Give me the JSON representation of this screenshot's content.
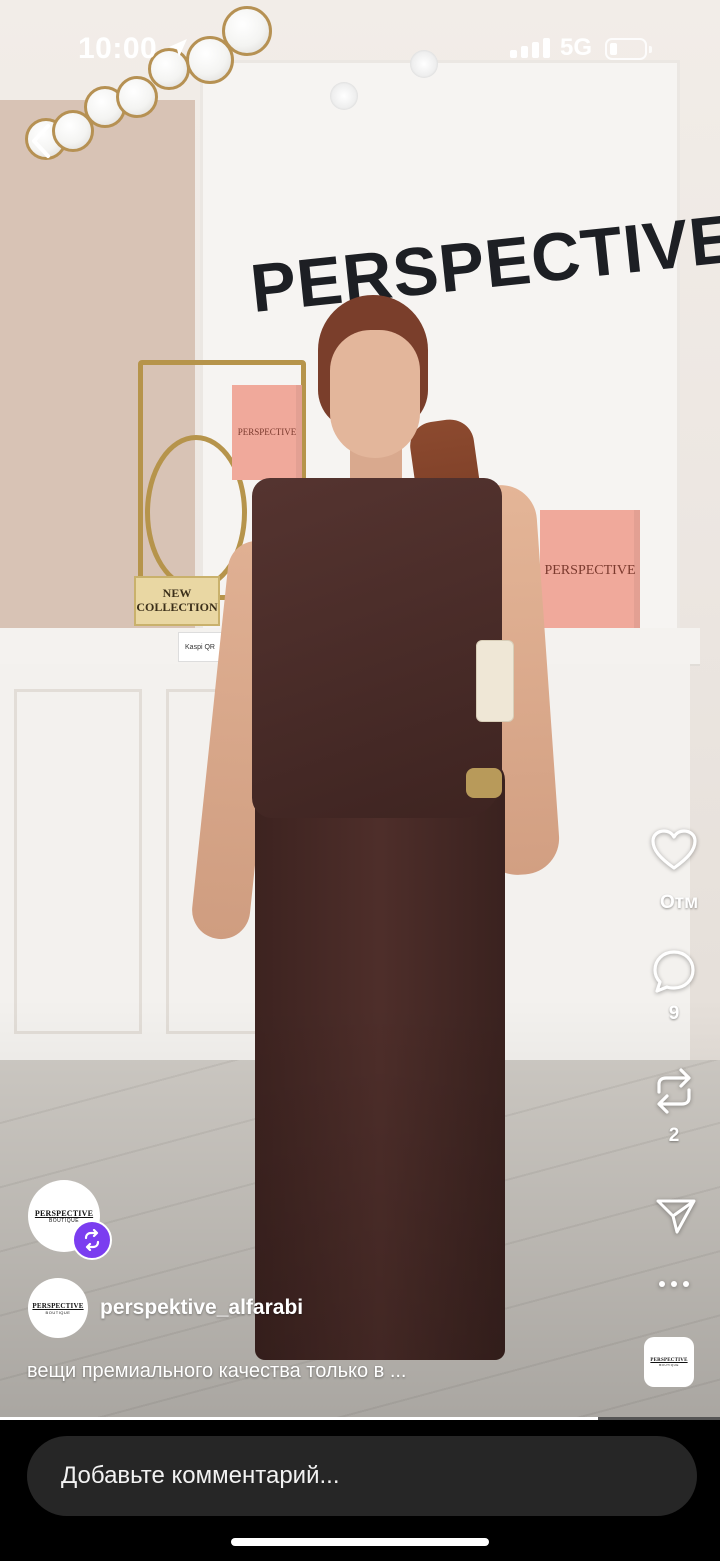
{
  "status_bar": {
    "time": "10:00",
    "network": "5G",
    "battery_level": 0.2
  },
  "scene": {
    "store_sign": "PERSPECTIVE",
    "bag_label": "PERSPECTIVE",
    "plaque": "NEW COLLECTION",
    "payment_sign": "Kaspi QR"
  },
  "actions": {
    "like_label": "Отм",
    "comments_count": "9",
    "reposts_count": "2"
  },
  "profile": {
    "logo_text": "PERSPECTIVE",
    "logo_sub": "BOUTIQUE",
    "username": "perspektive_alfarabi",
    "caption": "вещи премиального качества только в ..."
  },
  "playback": {
    "progress": 0.83
  },
  "comment_bar": {
    "placeholder": "Добавьте комментарий..."
  },
  "colors": {
    "remix_badge": "#7b3df0",
    "comment_field": "#262626",
    "background": "#000000"
  },
  "icons": {
    "back": "chevron-left-icon",
    "like": "heart-icon",
    "comment": "comment-bubble-icon",
    "repost": "repost-icon",
    "share": "paper-plane-icon",
    "more": "more-dots-icon",
    "remix": "remix-icon",
    "location": "location-arrow-icon"
  }
}
